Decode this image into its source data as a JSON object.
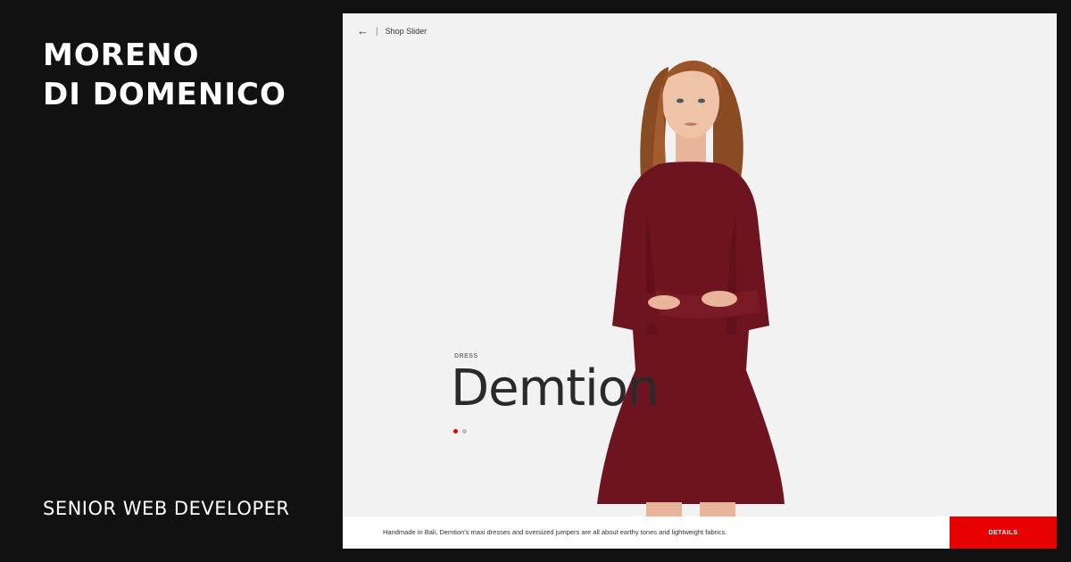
{
  "profile": {
    "name_line1": "MORENO",
    "name_line2": "DI DOMENICO",
    "role": "SENIOR WEB DEVELOPER"
  },
  "slider": {
    "back_icon": "arrow-left-icon",
    "separator": "|",
    "title": "Shop Slider",
    "category": "DRESS",
    "product_name": "Demtion",
    "pagination": {
      "total": 2,
      "active": 1
    },
    "description": "Handmade in Bali, Demtion's maxi dresses and oversized jumpers are all about earthy tones and lightweight fabrics.",
    "details_label": "DETAILS"
  },
  "colors": {
    "page_bg": "#111111",
    "frame_bg": "#f2f2f2",
    "accent": "#e60000",
    "dress": "#6e1420",
    "dot_inactive": "#bbbbbb"
  }
}
